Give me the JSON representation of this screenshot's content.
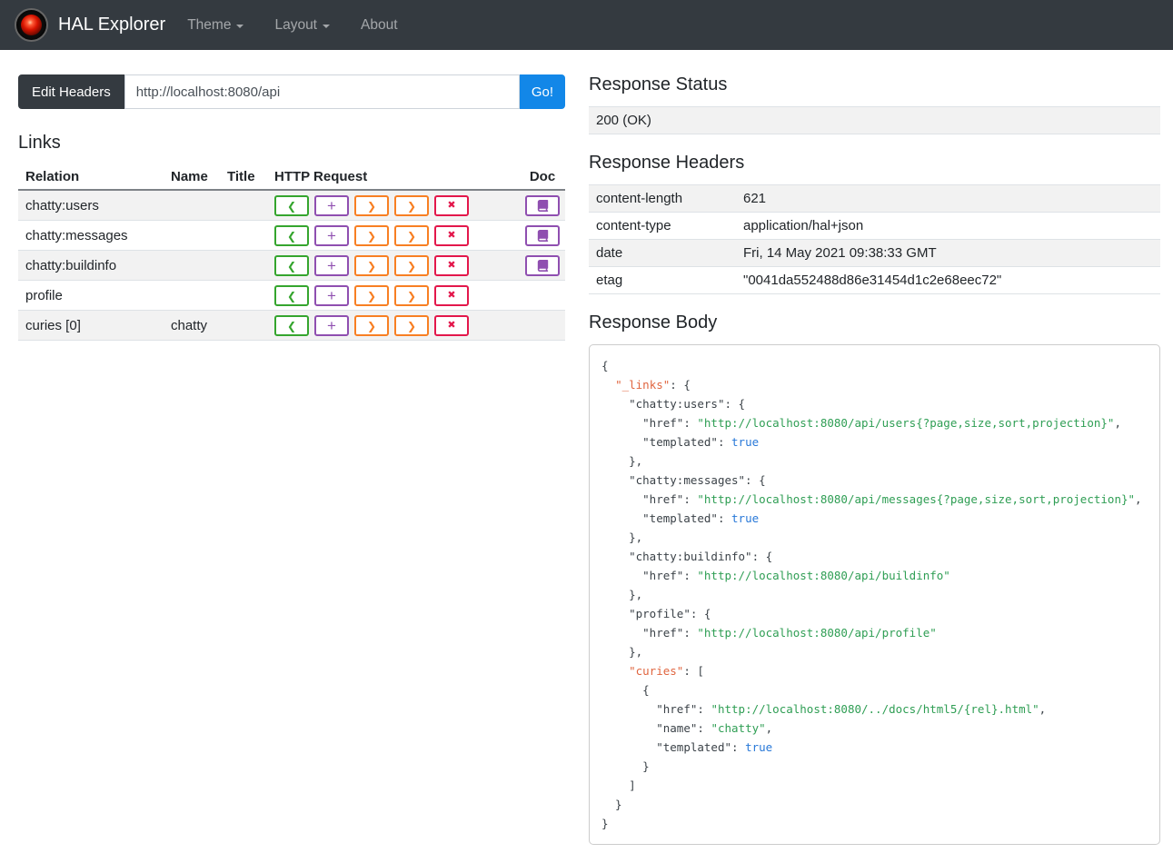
{
  "navbar": {
    "brand": "HAL Explorer",
    "items": [
      {
        "label": "Theme",
        "dropdown": true
      },
      {
        "label": "Layout",
        "dropdown": true
      },
      {
        "label": "About",
        "dropdown": false
      }
    ]
  },
  "address_bar": {
    "edit_headers_label": "Edit Headers",
    "url_value": "http://localhost:8080/api",
    "go_label": "Go!"
  },
  "links_section": {
    "title": "Links",
    "columns": [
      "Relation",
      "Name",
      "Title",
      "HTTP Request",
      "Doc"
    ],
    "http_buttons": [
      {
        "method": "get",
        "glyph": "❮",
        "color": "#35a52e"
      },
      {
        "method": "post",
        "glyph": "+",
        "color": "#8f4fb0"
      },
      {
        "method": "put",
        "glyph": "❯",
        "color": "#f87f23"
      },
      {
        "method": "patch",
        "glyph": "❯",
        "color": "#f87f23"
      },
      {
        "method": "delete",
        "glyph": "✖",
        "color": "#e3174b"
      }
    ],
    "doc_color": "#8f4fb0",
    "rows": [
      {
        "relation": "chatty:users",
        "name": "",
        "title": "",
        "has_doc": true
      },
      {
        "relation": "chatty:messages",
        "name": "",
        "title": "",
        "has_doc": true
      },
      {
        "relation": "chatty:buildinfo",
        "name": "",
        "title": "",
        "has_doc": true
      },
      {
        "relation": "profile",
        "name": "",
        "title": "",
        "has_doc": false
      },
      {
        "relation": "curies [0]",
        "name": "chatty",
        "title": "",
        "has_doc": false
      }
    ]
  },
  "response_status": {
    "title": "Response Status",
    "value": "200 (OK)"
  },
  "response_headers": {
    "title": "Response Headers",
    "rows": [
      {
        "name": "content-length",
        "value": "621"
      },
      {
        "name": "content-type",
        "value": "application/hal+json"
      },
      {
        "name": "date",
        "value": "Fri, 14 May 2021 09:38:33 GMT"
      },
      {
        "name": "etag",
        "value": "\"0041da552488d86e31454d1c2e68eec72\""
      }
    ]
  },
  "response_body": {
    "title": "Response Body",
    "syntax_colors": {
      "key": "#3b4248",
      "hal_key": "#e0653f",
      "string": "#2f9e54",
      "boolean": "#2878d8"
    },
    "lines": [
      [
        [
          "p",
          "{"
        ]
      ],
      [
        [
          "p",
          "  "
        ],
        [
          "hal",
          "\"_links\""
        ],
        [
          "p",
          ": {"
        ]
      ],
      [
        [
          "p",
          "    "
        ],
        [
          "key",
          "\"chatty:users\""
        ],
        [
          "p",
          ": {"
        ]
      ],
      [
        [
          "p",
          "      "
        ],
        [
          "key",
          "\"href\""
        ],
        [
          "p",
          ": "
        ],
        [
          "str",
          "\"http://localhost:8080/api/users{?page,size,sort,projection}\""
        ],
        [
          "p",
          ","
        ]
      ],
      [
        [
          "p",
          "      "
        ],
        [
          "key",
          "\"templated\""
        ],
        [
          "p",
          ": "
        ],
        [
          "bool",
          "true"
        ]
      ],
      [
        [
          "p",
          "    },"
        ]
      ],
      [
        [
          "p",
          "    "
        ],
        [
          "key",
          "\"chatty:messages\""
        ],
        [
          "p",
          ": {"
        ]
      ],
      [
        [
          "p",
          "      "
        ],
        [
          "key",
          "\"href\""
        ],
        [
          "p",
          ": "
        ],
        [
          "str",
          "\"http://localhost:8080/api/messages{?page,size,sort,projection}\""
        ],
        [
          "p",
          ","
        ]
      ],
      [
        [
          "p",
          "      "
        ],
        [
          "key",
          "\"templated\""
        ],
        [
          "p",
          ": "
        ],
        [
          "bool",
          "true"
        ]
      ],
      [
        [
          "p",
          "    },"
        ]
      ],
      [
        [
          "p",
          "    "
        ],
        [
          "key",
          "\"chatty:buildinfo\""
        ],
        [
          "p",
          ": {"
        ]
      ],
      [
        [
          "p",
          "      "
        ],
        [
          "key",
          "\"href\""
        ],
        [
          "p",
          ": "
        ],
        [
          "str",
          "\"http://localhost:8080/api/buildinfo\""
        ]
      ],
      [
        [
          "p",
          "    },"
        ]
      ],
      [
        [
          "p",
          "    "
        ],
        [
          "key",
          "\"profile\""
        ],
        [
          "p",
          ": {"
        ]
      ],
      [
        [
          "p",
          "      "
        ],
        [
          "key",
          "\"href\""
        ],
        [
          "p",
          ": "
        ],
        [
          "str",
          "\"http://localhost:8080/api/profile\""
        ]
      ],
      [
        [
          "p",
          "    },"
        ]
      ],
      [
        [
          "p",
          "    "
        ],
        [
          "hal",
          "\"curies\""
        ],
        [
          "p",
          ": ["
        ]
      ],
      [
        [
          "p",
          "      {"
        ]
      ],
      [
        [
          "p",
          "        "
        ],
        [
          "key",
          "\"href\""
        ],
        [
          "p",
          ": "
        ],
        [
          "str",
          "\"http://localhost:8080/../docs/html5/{rel}.html\""
        ],
        [
          "p",
          ","
        ]
      ],
      [
        [
          "p",
          "        "
        ],
        [
          "key",
          "\"name\""
        ],
        [
          "p",
          ": "
        ],
        [
          "str",
          "\"chatty\""
        ],
        [
          "p",
          ","
        ]
      ],
      [
        [
          "p",
          "        "
        ],
        [
          "key",
          "\"templated\""
        ],
        [
          "p",
          ": "
        ],
        [
          "bool",
          "true"
        ]
      ],
      [
        [
          "p",
          "      }"
        ]
      ],
      [
        [
          "p",
          "    ]"
        ]
      ],
      [
        [
          "p",
          "  }"
        ]
      ],
      [
        [
          "p",
          "}"
        ]
      ]
    ]
  }
}
